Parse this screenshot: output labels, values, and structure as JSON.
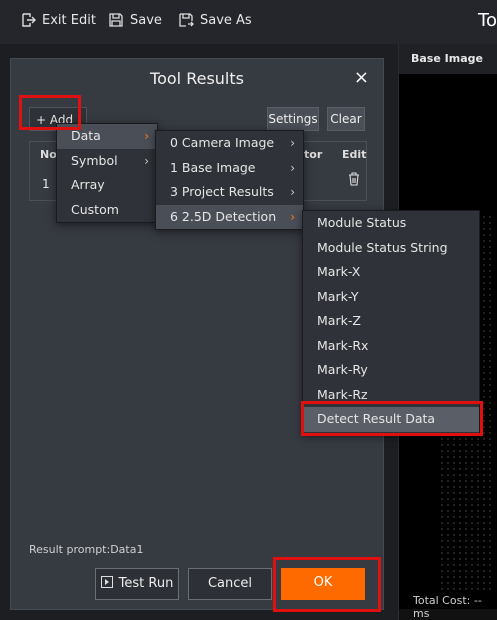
{
  "toolbar": {
    "exit_edit": "Exit Edit",
    "save": "Save",
    "save_as": "Save As",
    "right_title": "To"
  },
  "image_panel": {
    "header": "Base Image",
    "footer": "Total Cost: --ms"
  },
  "dialog": {
    "title": "Tool Results",
    "close": "×",
    "add_label": "+ Add",
    "settings_label": "Settings",
    "clear_label": "Clear",
    "columns": {
      "no": "No",
      "operator": "tor",
      "edit": "Edit"
    },
    "row_no": "1",
    "result_prompt": "Result prompt:Data1",
    "test_run_label": "Test Run",
    "cancel_label": "Cancel",
    "ok_label": "OK"
  },
  "menu_level1": [
    {
      "label": "Data",
      "has_sub": true
    },
    {
      "label": "Symbol",
      "has_sub": true
    },
    {
      "label": "Array",
      "has_sub": false
    },
    {
      "label": "Custom",
      "has_sub": false
    }
  ],
  "menu_level2": [
    {
      "label": "0 Camera Image",
      "has_sub": true
    },
    {
      "label": "1 Base Image",
      "has_sub": true
    },
    {
      "label": "3 Project Results",
      "has_sub": true
    },
    {
      "label": "6 2.5D Detection",
      "has_sub": true
    }
  ],
  "menu_level3": [
    {
      "label": "Module Status"
    },
    {
      "label": "Module Status String"
    },
    {
      "label": "Mark-X"
    },
    {
      "label": "Mark-Y"
    },
    {
      "label": "Mark-Z"
    },
    {
      "label": "Mark-Rx"
    },
    {
      "label": "Mark-Ry"
    },
    {
      "label": "Mark-Rz"
    },
    {
      "label": "Detect Result Data"
    }
  ],
  "submenu_arrow": "›",
  "colors": {
    "accent": "#ff6a00",
    "highlight_box": "#e01010",
    "dialog_bg": "#363a41"
  }
}
